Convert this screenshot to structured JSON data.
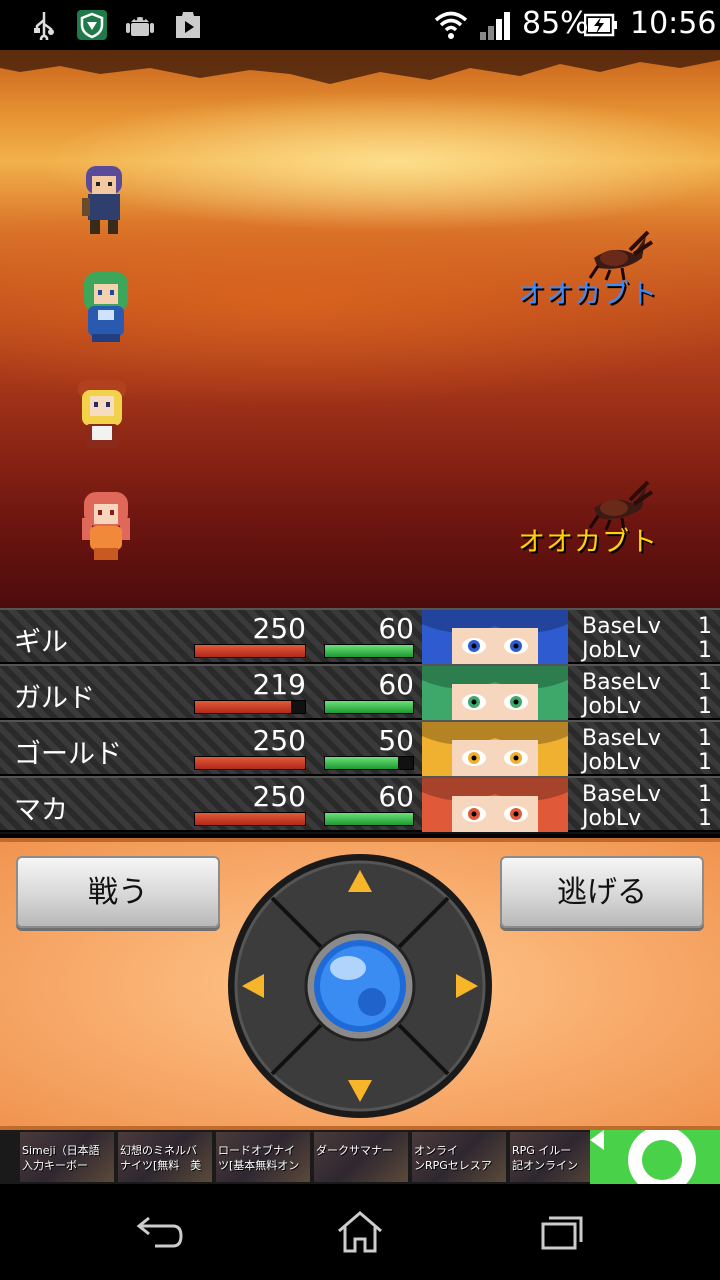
{
  "status_bar": {
    "battery_percent": "85%",
    "time": "10:56",
    "icons": [
      "usb-icon",
      "shield-app-icon",
      "android-icon",
      "play-store-icon",
      "wifi-icon",
      "signal-icon",
      "battery-charging-icon"
    ]
  },
  "battle": {
    "enemies": [
      {
        "name": "オオカブト",
        "color": "#3b8bff"
      },
      {
        "name": "オオカブト",
        "color": "#ffd400"
      }
    ],
    "heroes": [
      "hero-purple-hair",
      "hero-green-hair",
      "hero-blonde-hat",
      "hero-pink-hair"
    ]
  },
  "party": [
    {
      "name": "ギル",
      "hp": "250",
      "mp": "60",
      "hp_ratio": 1.0,
      "mp_ratio": 1.0,
      "base_label": "BaseLv",
      "base_lv": "1",
      "job_label": "JobLv",
      "job_lv": "1",
      "portrait_color": "#2f5bd0"
    },
    {
      "name": "ガルド",
      "hp": "219",
      "mp": "60",
      "hp_ratio": 0.876,
      "mp_ratio": 1.0,
      "base_label": "BaseLv",
      "base_lv": "1",
      "job_label": "JobLv",
      "job_lv": "1",
      "portrait_color": "#3da86a"
    },
    {
      "name": "ゴールド",
      "hp": "250",
      "mp": "50",
      "hp_ratio": 1.0,
      "mp_ratio": 0.833,
      "base_label": "BaseLv",
      "base_lv": "1",
      "job_label": "JobLv",
      "job_lv": "1",
      "portrait_color": "#f0b030"
    },
    {
      "name": "マカ",
      "hp": "250",
      "mp": "60",
      "hp_ratio": 1.0,
      "mp_ratio": 1.0,
      "base_label": "BaseLv",
      "base_lv": "1",
      "job_label": "JobLv",
      "job_lv": "1",
      "portrait_color": "#e05a3a"
    }
  ],
  "commands": {
    "fight_label": "戦う",
    "flee_label": "逃げる"
  },
  "ads": [
    {
      "line1": "Simeji（日本語",
      "line2": "入力キーボー"
    },
    {
      "line1": "幻想のミネルバ",
      "line2": "ナイツ[無料　美"
    },
    {
      "line1": "ロードオブナイ",
      "line2": "ツ[基本無料オン"
    },
    {
      "line1": "ダークサマナー",
      "line2": ""
    },
    {
      "line1": "オンライ",
      "line2": "ンRPGセレスア"
    },
    {
      "line1": "RPG イルー",
      "line2": "記オンライン"
    }
  ],
  "colors": {
    "hp_bar": "#c0321e",
    "mp_bar": "#2fb040",
    "panel": "#f7a868"
  }
}
